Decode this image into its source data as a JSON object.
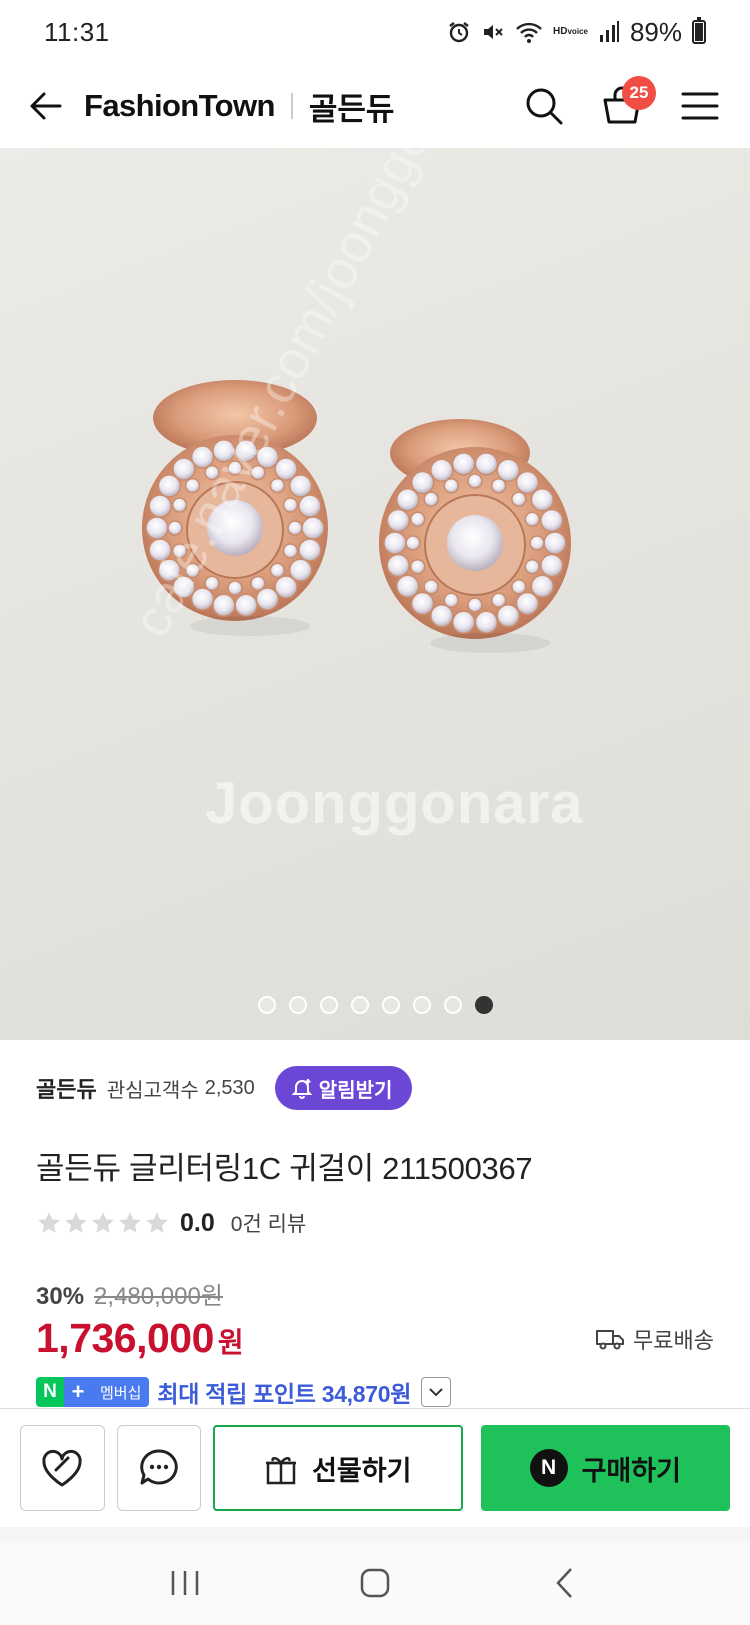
{
  "status_bar": {
    "time": "11:31",
    "hd_top": "HD",
    "hd_bottom": "voice",
    "battery_percent": "89%",
    "battery_level": 0.89
  },
  "header": {
    "brand": "FashionTown",
    "store": "골든듀",
    "cart_count": "25",
    "icons": [
      "back-arrow-icon",
      "search-icon",
      "cart-icon",
      "menu-icon"
    ]
  },
  "gallery": {
    "watermark": "Joonggonara",
    "watermark_diagonal": "cafe.naver.com/joonggonara",
    "total_images": 8,
    "active_index": 7
  },
  "seller": {
    "name": "골든듀",
    "fans_label": "관심고객수",
    "fans_count": "2,530",
    "alarm_button": "알림받기"
  },
  "product": {
    "title": "골든듀 글리터링1C 귀걸이 211500367",
    "rating": "0.0",
    "rating_stars": 0,
    "review_count": "0건 리뷰",
    "discount": "30%",
    "original_price": "2,480,000원",
    "price": "1,736,000",
    "currency": "원",
    "shipping": "무료배송",
    "membership_n": "N",
    "membership_plus": "+",
    "membership_label": "멤버십",
    "points_text": "최대 적립 포인트 34,870원"
  },
  "actions": {
    "gift_label": "선물하기",
    "buy_label": "구매하기",
    "buy_badge": "N"
  },
  "colors": {
    "price_red": "#c9102f",
    "alarm_purple": "#6c47d6",
    "buy_green": "#1fc15a",
    "point_blue": "#3b5bd8",
    "cart_badge": "#f04e45"
  }
}
